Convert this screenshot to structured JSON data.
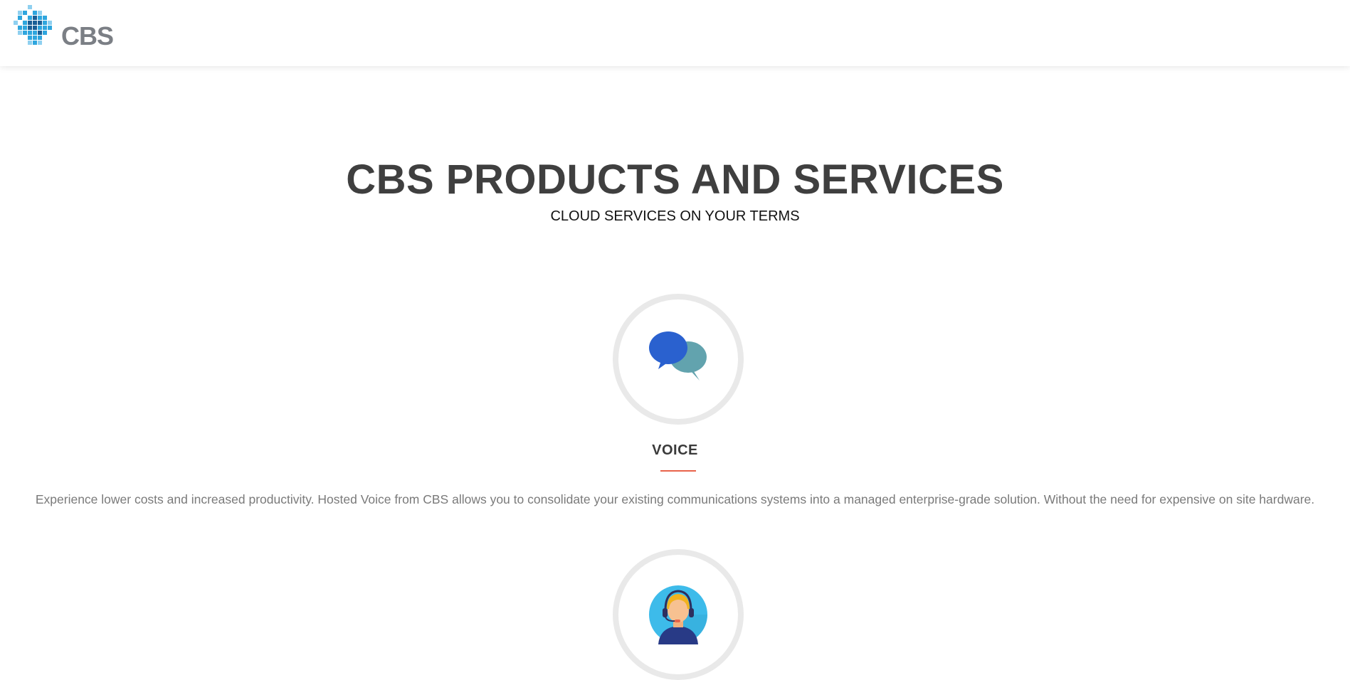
{
  "header": {
    "logo_text": "CBS"
  },
  "hero": {
    "title": "CBS PRODUCTS AND SERVICES",
    "subtitle": "CLOUD SERVICES ON YOUR TERMS"
  },
  "services": [
    {
      "icon": "speech-bubbles-icon",
      "title": "VOICE",
      "description": "Experience lower costs and increased productivity. Hosted Voice from CBS allows you to consolidate your existing communications systems into a managed enterprise-grade solution. Without the need for expensive on site hardware."
    },
    {
      "icon": "support-agent-icon"
    }
  ],
  "colors": {
    "title": "#3f3f3f",
    "accent_divider": "#e8634a",
    "circle_border": "#e9e9e9",
    "logo_blue": "#2a9fd8",
    "logo_gray": "#7b7f85"
  }
}
